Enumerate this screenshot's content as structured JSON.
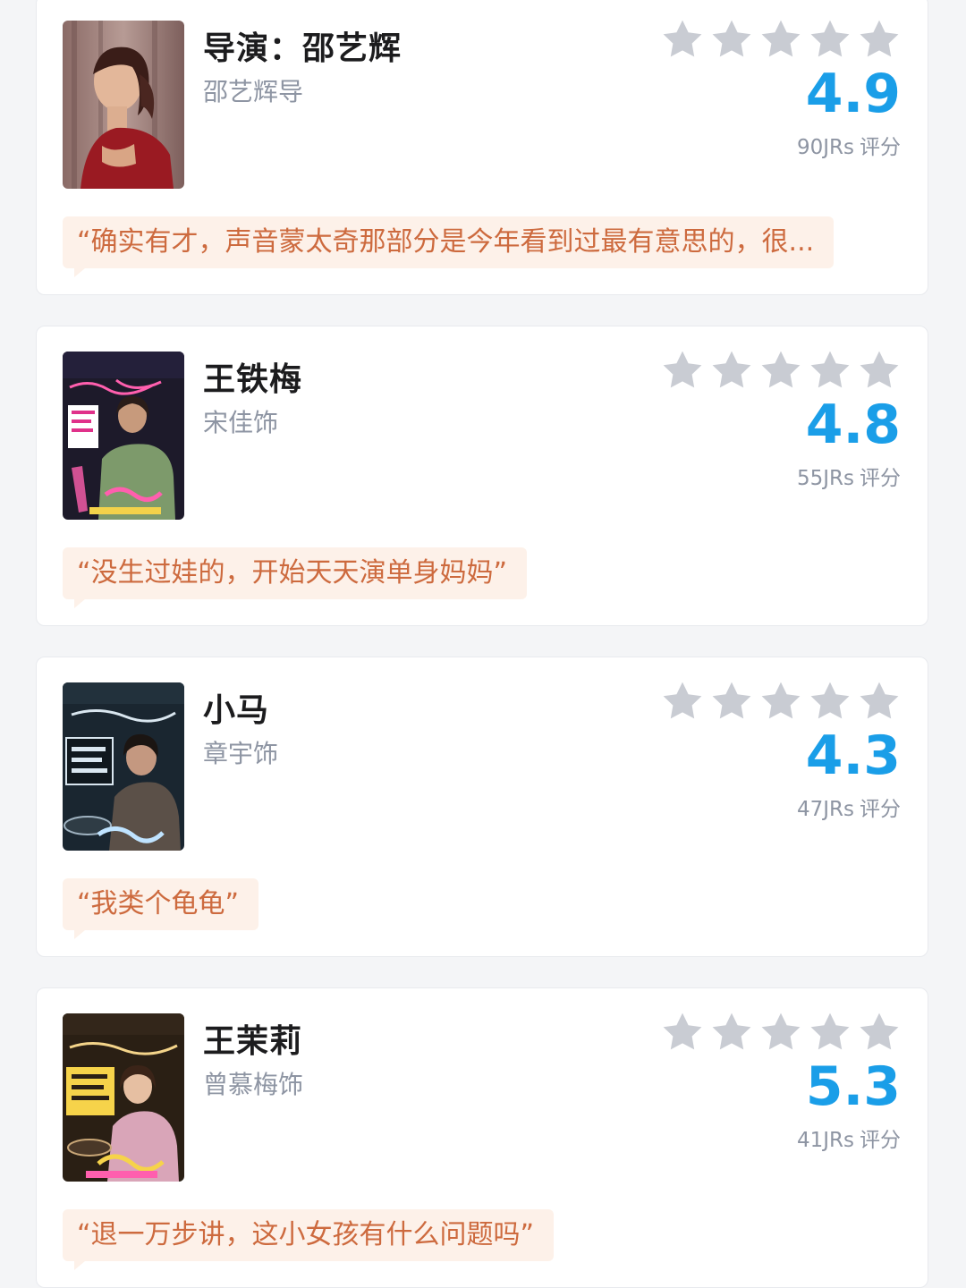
{
  "rating_label_suffix": "评分",
  "colors": {
    "score": "#1a9ee8",
    "star": "#c9ccd3",
    "quote_text": "#cd6a3e",
    "quote_bg": "#fdf1e9"
  },
  "cards": [
    {
      "name": "导演：邵艺辉",
      "role": "邵艺辉导",
      "score": "4.9",
      "rating_count": "90JRs",
      "stars_filled": 0,
      "quote": "“确实有才，声音蒙太奇那部分是今年看到过最有意思的，很...",
      "poster_icon": "director-photo"
    },
    {
      "name": "王铁梅",
      "role": "宋佳饰",
      "score": "4.8",
      "rating_count": "55JRs",
      "stars_filled": 0,
      "quote": "“没生过娃的，开始天天演单身妈妈”",
      "poster_icon": "character-poster"
    },
    {
      "name": "小马",
      "role": "章宇饰",
      "score": "4.3",
      "rating_count": "47JRs",
      "stars_filled": 0,
      "quote": "“我类个龟龟”",
      "poster_icon": "character-poster"
    },
    {
      "name": "王茉莉",
      "role": "曾慕梅饰",
      "score": "5.3",
      "rating_count": "41JRs",
      "stars_filled": 0,
      "quote": "“退一万步讲，这小女孩有什么问题吗”",
      "poster_icon": "character-poster"
    }
  ]
}
